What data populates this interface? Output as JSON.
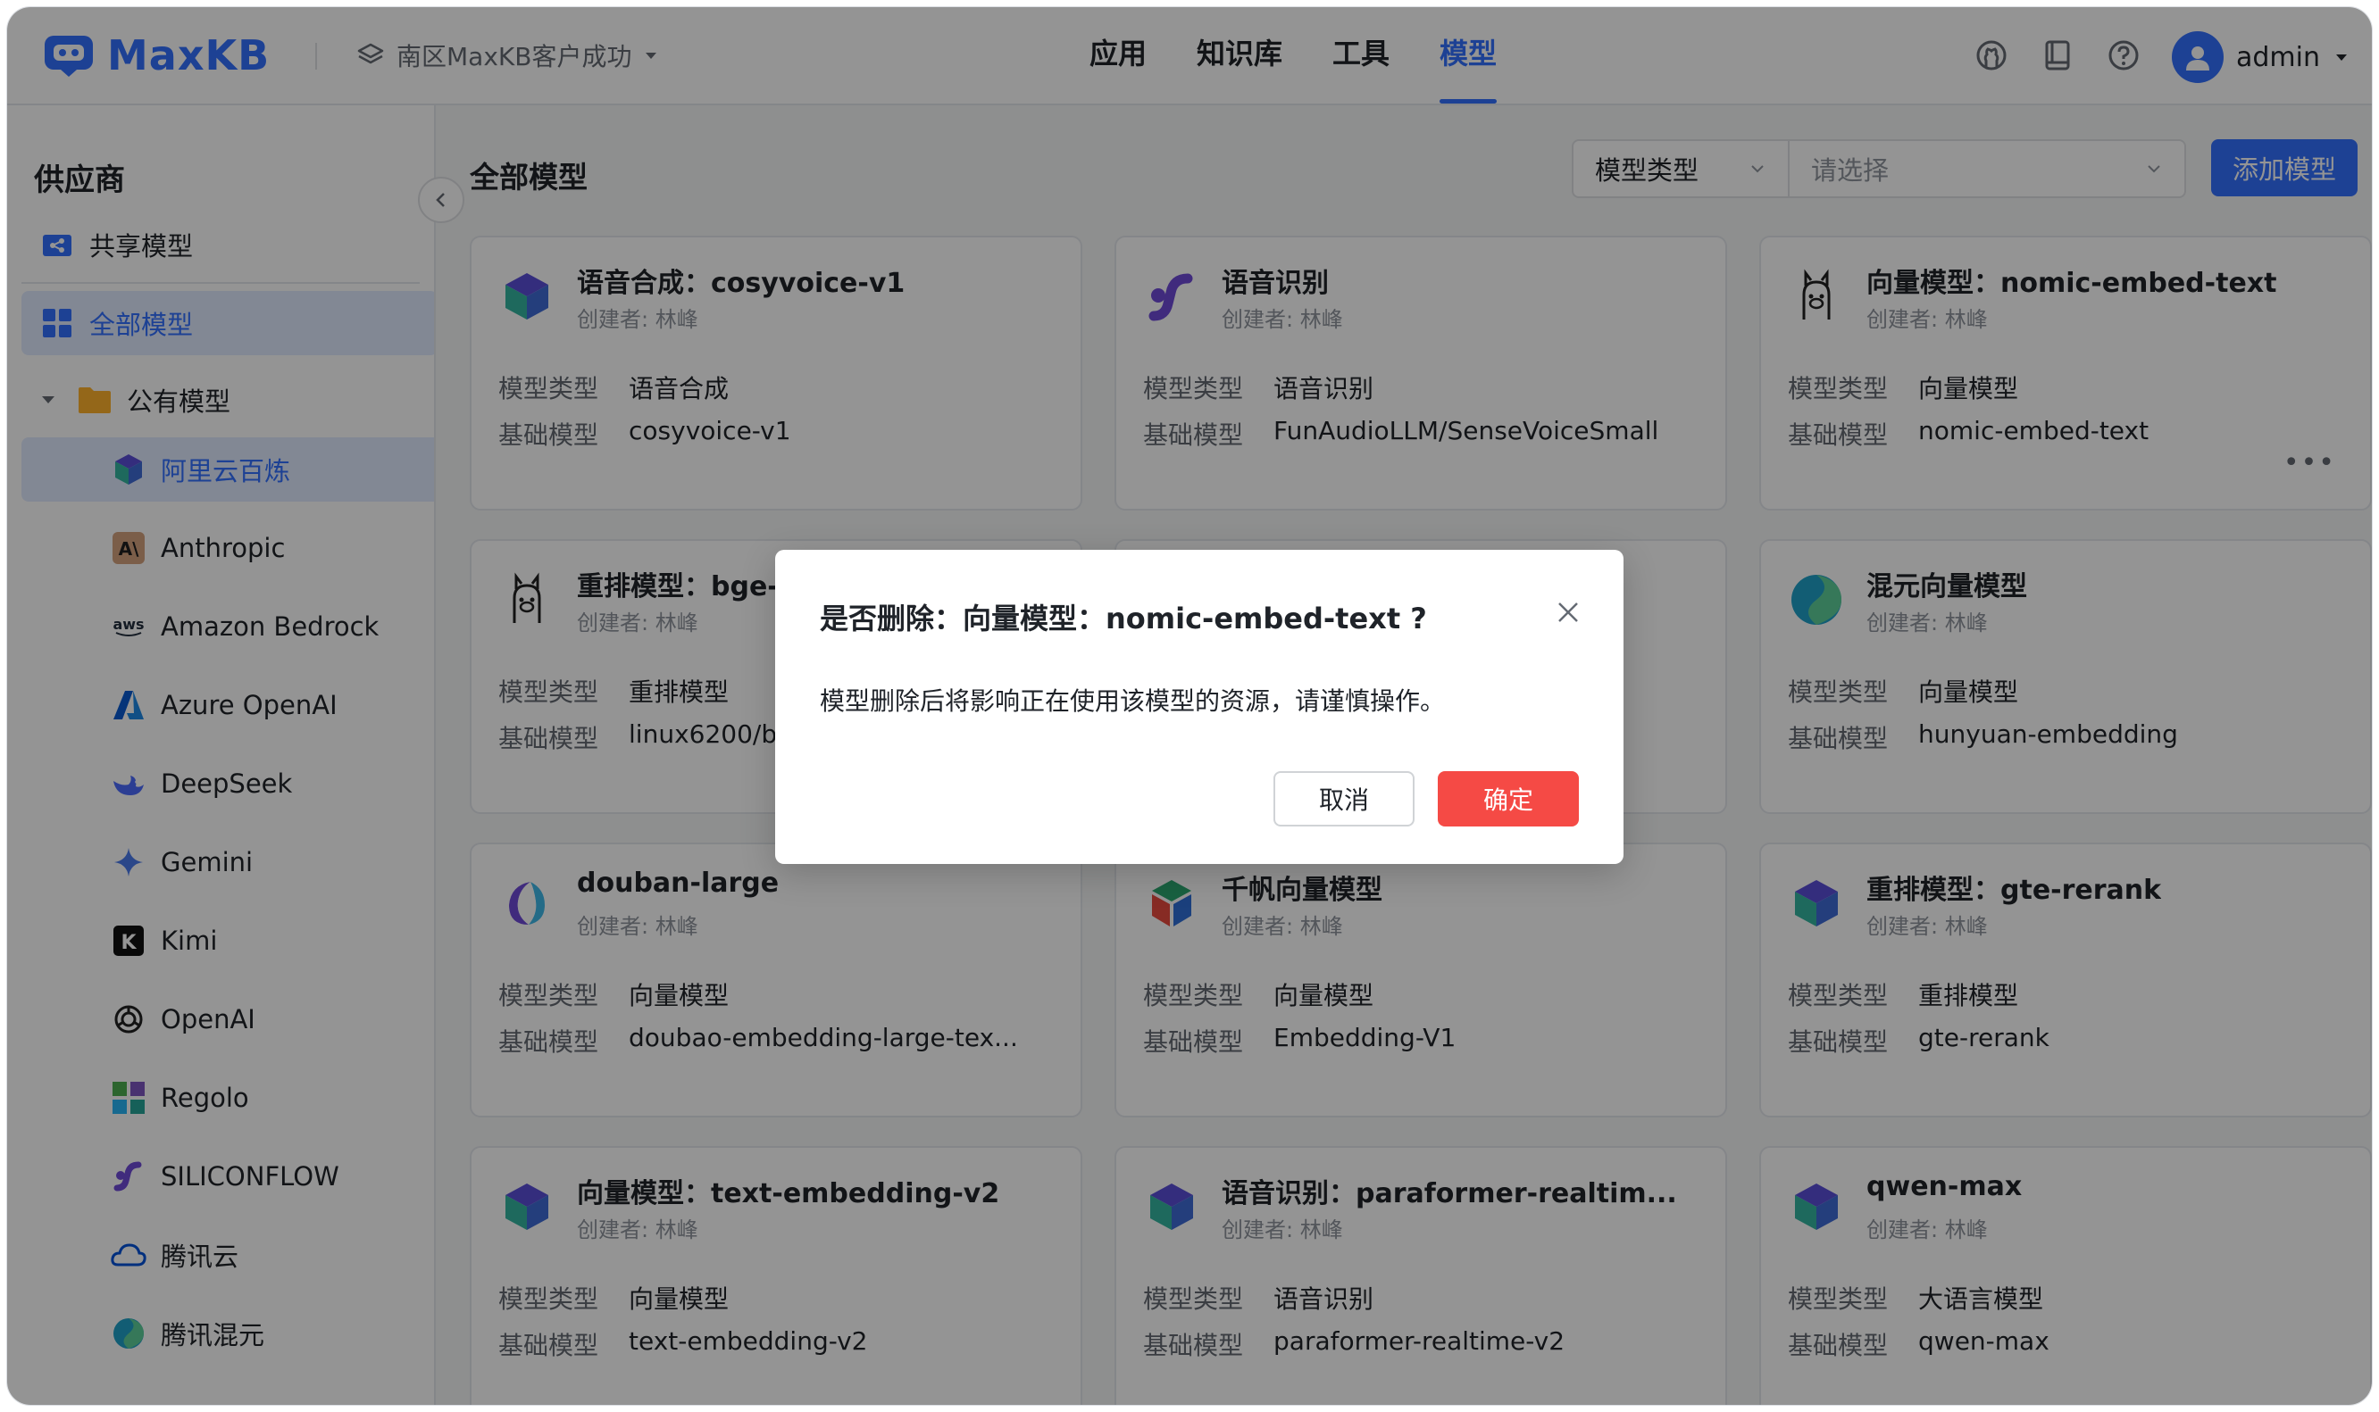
{
  "app": {
    "logo": "MaxKB",
    "workspace": "南区MaxKB客户成功",
    "user": "admin"
  },
  "nav": [
    {
      "label": "应用",
      "active": false
    },
    {
      "label": "知识库",
      "active": false
    },
    {
      "label": "工具",
      "active": false
    },
    {
      "label": "模型",
      "active": true
    }
  ],
  "sidebar": {
    "title": "供应商",
    "shared": "共享模型",
    "all": "全部模型",
    "public_folder": "公有模型",
    "providers": [
      {
        "label": "阿里云百炼",
        "icon": "aliyun-bailian-icon"
      },
      {
        "label": "Anthropic",
        "icon": "anthropic-icon"
      },
      {
        "label": "Amazon Bedrock",
        "icon": "aws-icon"
      },
      {
        "label": "Azure OpenAI",
        "icon": "azure-icon"
      },
      {
        "label": "DeepSeek",
        "icon": "deepseek-icon"
      },
      {
        "label": "Gemini",
        "icon": "gemini-icon"
      },
      {
        "label": "Kimi",
        "icon": "kimi-icon"
      },
      {
        "label": "OpenAI",
        "icon": "openai-icon"
      },
      {
        "label": "Regolo",
        "icon": "regolo-icon"
      },
      {
        "label": "SILICONFLOW",
        "icon": "siliconflow-icon"
      },
      {
        "label": "腾讯云",
        "icon": "tencent-cloud-icon"
      },
      {
        "label": "腾讯混元",
        "icon": "hunyuan-icon"
      }
    ]
  },
  "main": {
    "title": "全部模型",
    "filter_type": "模型类型",
    "filter_placeholder": "请选择",
    "add_button": "添加模型",
    "type_key": "模型类型",
    "base_key": "基础模型",
    "cards": [
      {
        "title": "语音合成：cosyvoice-v1",
        "author": "创建者: 林峰",
        "type": "语音合成",
        "base": "cosyvoice-v1",
        "icon": "bailian-icon"
      },
      {
        "title": "语音识别",
        "author": "创建者: 林峰",
        "type": "语音识别",
        "base": "FunAudioLLM/SenseVoiceSmall",
        "icon": "siliconflow-icon"
      },
      {
        "title": "向量模型：nomic-embed-text",
        "author": "创建者: 林峰",
        "type": "向量模型",
        "base": "nomic-embed-text",
        "icon": "ollama-icon",
        "more": "•••"
      },
      {
        "title": "重排模型：bge-r",
        "author": "创建者: 林峰",
        "type": "重排模型",
        "base": "linux6200/bg",
        "icon": "ollama-icon"
      },
      {
        "title": "",
        "author": "",
        "type": "",
        "base": "",
        "icon": ""
      },
      {
        "title": "混元向量模型",
        "author": "创建者: 林峰",
        "type": "向量模型",
        "base": "hunyuan-embedding",
        "icon": "hunyuan-icon"
      },
      {
        "title": "douban-large",
        "author": "创建者: 林峰",
        "type": "向量模型",
        "base": "doubao-embedding-large-tex...",
        "icon": "doubao-icon"
      },
      {
        "title": "千帆向量模型",
        "author": "创建者: 林峰",
        "type": "向量模型",
        "base": "Embedding-V1",
        "icon": "qianfan-icon"
      },
      {
        "title": "重排模型：gte-rerank",
        "author": "创建者: 林峰",
        "type": "重排模型",
        "base": "gte-rerank",
        "icon": "bailian-icon"
      },
      {
        "title": "向量模型：text-embedding-v2",
        "author": "创建者: 林峰",
        "type": "向量模型",
        "base": "text-embedding-v2",
        "icon": "bailian-icon"
      },
      {
        "title": "语音识别：paraformer-realtim...",
        "author": "创建者: 林峰",
        "type": "语音识别",
        "base": "paraformer-realtime-v2",
        "icon": "bailian-icon"
      },
      {
        "title": "qwen-max",
        "author": "创建者: 林峰",
        "type": "大语言模型",
        "base": "qwen-max",
        "icon": "bailian-icon"
      }
    ]
  },
  "dialog": {
    "title": "是否删除：向量模型：nomic-embed-text ?",
    "body": "模型删除后将影响正在使用该模型的资源，请谨慎操作。",
    "cancel": "取消",
    "confirm": "确定"
  },
  "colors": {
    "primary": "#3370ff",
    "danger": "#f54a45",
    "overlay": "rgba(0,0,0,0.42)"
  }
}
